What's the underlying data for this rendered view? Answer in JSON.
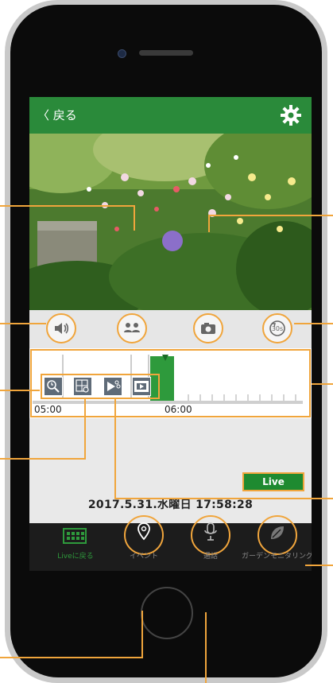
{
  "header": {
    "back_label": "〈 戻る"
  },
  "controls": [
    "speaker-icon",
    "people-icon",
    "camera-icon",
    "replay-30s-icon"
  ],
  "controls_badge": "30s",
  "timeline": {
    "start_label": "05:00",
    "end_label": "06:00"
  },
  "tools": [
    "clock-search-icon",
    "grid-search-icon",
    "scissors-icon",
    "film-icon"
  ],
  "live_button": "Live",
  "datetime": "2017.5.31.水曜日 17:58:28",
  "nav": {
    "back_live": "Liveに戻る",
    "event": "イベント",
    "call": "通話",
    "garden": "ガーデンモニタリング"
  },
  "colors": {
    "accent": "#2a8a3a",
    "callout": "#f0a53c",
    "nav_bg": "#1c1c1c"
  }
}
